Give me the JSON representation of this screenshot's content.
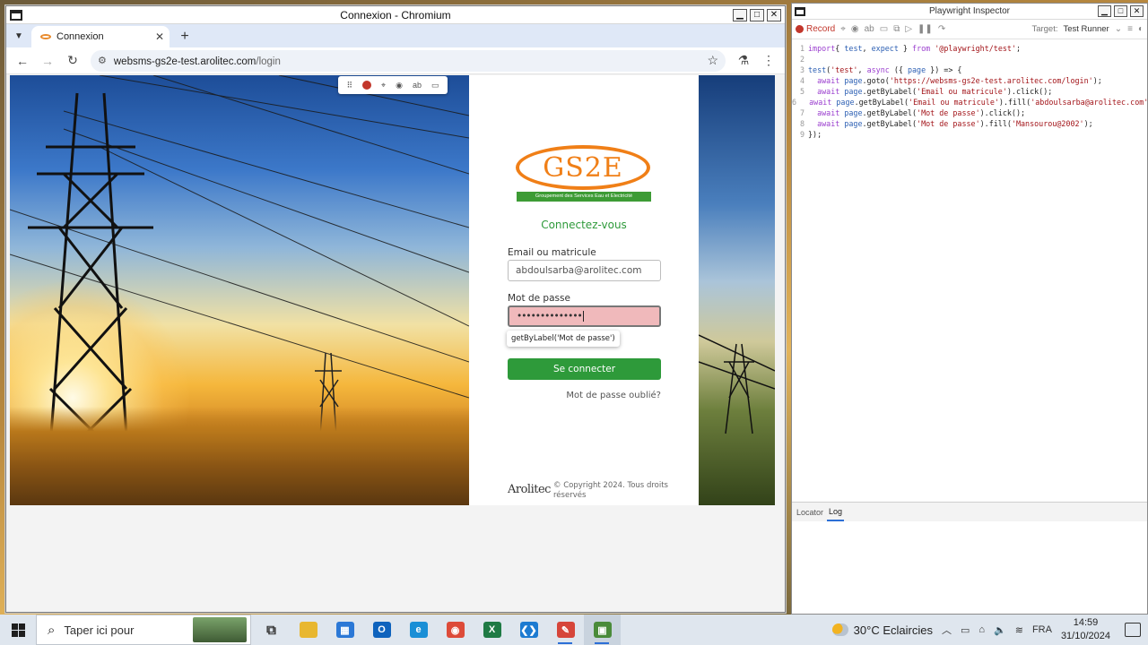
{
  "browser": {
    "window_title": "Connexion - Chromium",
    "tab_title": "Connexion",
    "url_host": "websms-gs2e-test.arolitec.com",
    "url_path": "/login"
  },
  "login": {
    "logo_text": "GS2E",
    "logo_tagline": "Groupement des Services Eau et Electricité",
    "heading": "Connectez-vous",
    "email_label": "Email ou matricule",
    "email_value": "abdoulsarba@arolitec.com",
    "password_label": "Mot de passe",
    "password_value": "••••••••••••••",
    "locator_tooltip": "getByLabel('Mot de passe')",
    "submit_label": "Se connecter",
    "forgot_label": "Mot de passe oublié?",
    "footer_brand": "Arolitec",
    "footer_copyright": "© Copyright 2024. Tous droits réservés"
  },
  "inspector": {
    "window_title": "Playwright Inspector",
    "record_label": "Record",
    "target_label": "Target:",
    "target_value": "Test Runner",
    "code_lines": [
      {
        "n": "1",
        "parts": [
          [
            "kw",
            "import"
          ],
          [
            "",
            "{ "
          ],
          [
            "fn",
            "test"
          ],
          [
            "",
            ", "
          ],
          [
            "fn",
            "expect"
          ],
          [
            "",
            " } "
          ],
          [
            "kw",
            "from"
          ],
          [
            "str",
            " '@playwright/test'"
          ],
          [
            "",
            ";"
          ]
        ]
      },
      {
        "n": "2",
        "parts": []
      },
      {
        "n": "3",
        "parts": [
          [
            "fn",
            "test"
          ],
          [
            "",
            "("
          ],
          [
            "str",
            "'test'"
          ],
          [
            "",
            ", "
          ],
          [
            "kw",
            "async"
          ],
          [
            "",
            " ({ "
          ],
          [
            "fn",
            "page"
          ],
          [
            "",
            " }) => {"
          ]
        ]
      },
      {
        "n": "4",
        "parts": [
          [
            "kw",
            "  await"
          ],
          [
            "",
            " "
          ],
          [
            "fn",
            "page"
          ],
          [
            "",
            ".goto("
          ],
          [
            "str",
            "'https://websms-gs2e-test.arolitec.com/login'"
          ],
          [
            "",
            ");"
          ]
        ]
      },
      {
        "n": "5",
        "parts": [
          [
            "kw",
            "  await"
          ],
          [
            "",
            " "
          ],
          [
            "fn",
            "page"
          ],
          [
            "",
            ".getByLabel("
          ],
          [
            "str",
            "'Email ou matricule'"
          ],
          [
            "",
            ").click();"
          ]
        ]
      },
      {
        "n": "6",
        "parts": [
          [
            "kw",
            "  await"
          ],
          [
            "",
            " "
          ],
          [
            "fn",
            "page"
          ],
          [
            "",
            ".getByLabel("
          ],
          [
            "str",
            "'Email ou matricule'"
          ],
          [
            "",
            ").fill("
          ],
          [
            "str",
            "'abdoulsarba@arolitec.com'"
          ],
          [
            "",
            ");"
          ]
        ]
      },
      {
        "n": "7",
        "parts": [
          [
            "kw",
            "  await"
          ],
          [
            "",
            " "
          ],
          [
            "fn",
            "page"
          ],
          [
            "",
            ".getByLabel("
          ],
          [
            "str",
            "'Mot de passe'"
          ],
          [
            "",
            ").click();"
          ]
        ]
      },
      {
        "n": "8",
        "parts": [
          [
            "kw",
            "  await"
          ],
          [
            "",
            " "
          ],
          [
            "fn",
            "page"
          ],
          [
            "",
            ".getByLabel("
          ],
          [
            "str",
            "'Mot de passe'"
          ],
          [
            "",
            ").fill("
          ],
          [
            "str",
            "'Mansourou@2002'"
          ],
          [
            "",
            ");"
          ]
        ]
      },
      {
        "n": "9",
        "parts": [
          [
            "",
            "});"
          ]
        ]
      }
    ],
    "tabs": [
      "Locator",
      "Log"
    ]
  },
  "taskbar": {
    "search_placeholder": "Taper ici pour",
    "weather": "30°C  Eclaircies",
    "language": "FRA",
    "time": "14:59",
    "date": "31/10/2024",
    "apps": [
      {
        "name": "task-view",
        "color": "#333333",
        "glyph": "⧉"
      },
      {
        "name": "file-explorer",
        "color": "#e8b730",
        "glyph": ""
      },
      {
        "name": "microsoft-store",
        "color": "#2b78d6",
        "glyph": "▦"
      },
      {
        "name": "outlook",
        "color": "#0f63bd",
        "glyph": "O"
      },
      {
        "name": "edge",
        "color": "#1a8fd6",
        "glyph": "e"
      },
      {
        "name": "chrome",
        "color": "#dd4b39",
        "glyph": "◉"
      },
      {
        "name": "excel",
        "color": "#1f7a44",
        "glyph": "X"
      },
      {
        "name": "vscode",
        "color": "#1d7bd1",
        "glyph": "❮❯"
      },
      {
        "name": "playwright",
        "color": "#d6453a",
        "glyph": "✎"
      },
      {
        "name": "chromium-playwright",
        "color": "#4a8b3a",
        "glyph": "▣"
      }
    ]
  }
}
